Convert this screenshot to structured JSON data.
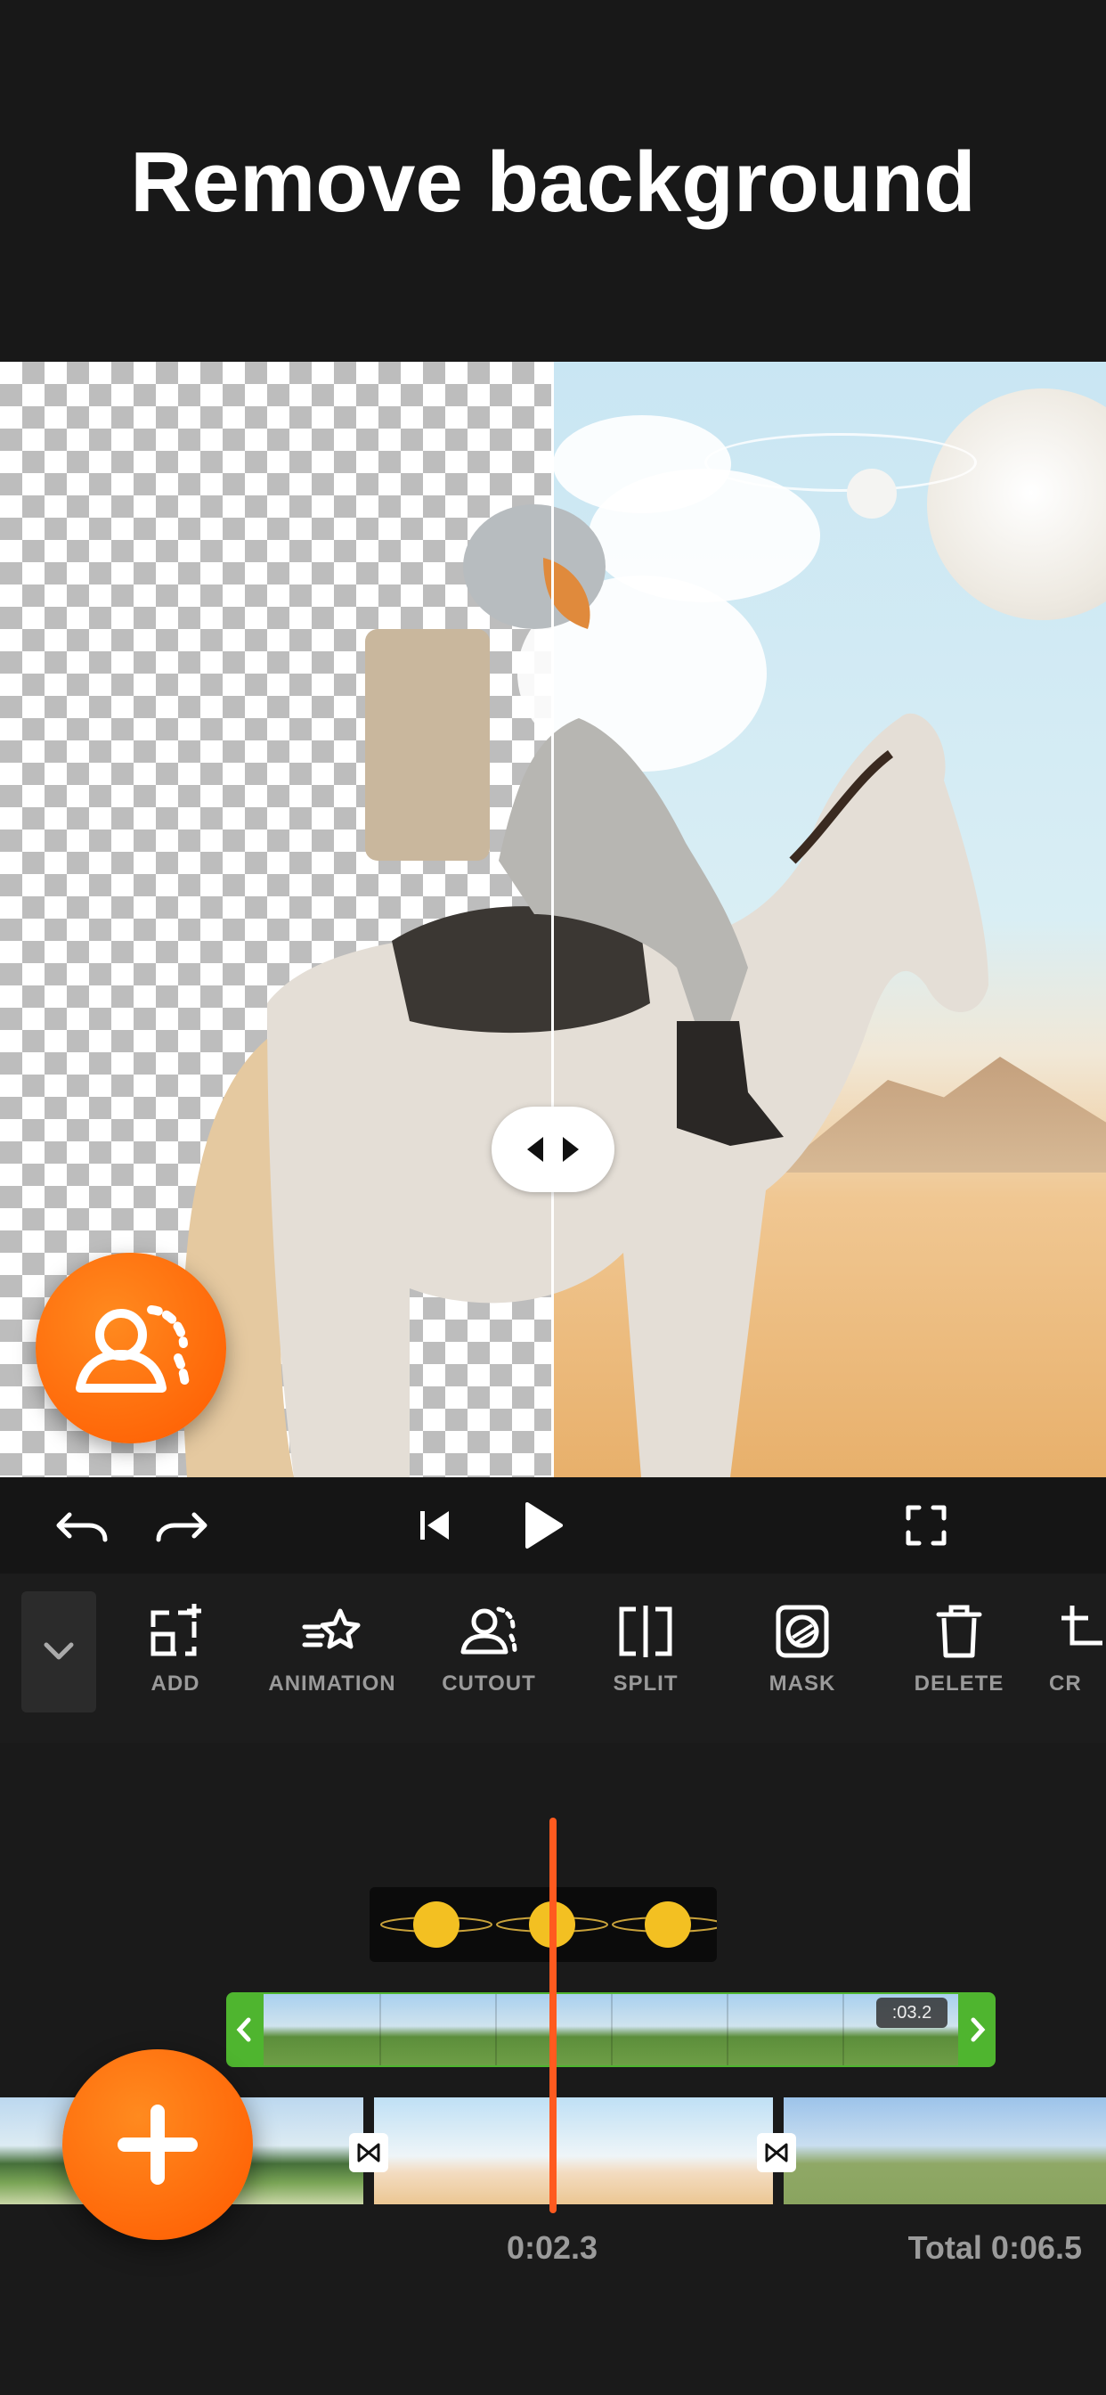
{
  "header": {
    "title": "Remove background"
  },
  "toolbar": {
    "tools": [
      {
        "label": "ADD",
        "icon": "add-icon"
      },
      {
        "label": "ANIMATION",
        "icon": "animation-star-icon"
      },
      {
        "label": "CUTOUT",
        "icon": "cutout-person-icon"
      },
      {
        "label": "SPLIT",
        "icon": "split-icon"
      },
      {
        "label": "MASK",
        "icon": "mask-icon"
      },
      {
        "label": "DELETE",
        "icon": "trash-icon"
      },
      {
        "label": "CR",
        "icon": "crop-icon"
      }
    ]
  },
  "timeline": {
    "clip_duration": ":03.2",
    "current_time": "0:02.3",
    "total_time": "Total 0:06.5"
  },
  "colors": {
    "accent": "#ff6a00",
    "clip_border": "#4fb52f",
    "playhead": "#ff5a1f",
    "background": "#181818"
  }
}
